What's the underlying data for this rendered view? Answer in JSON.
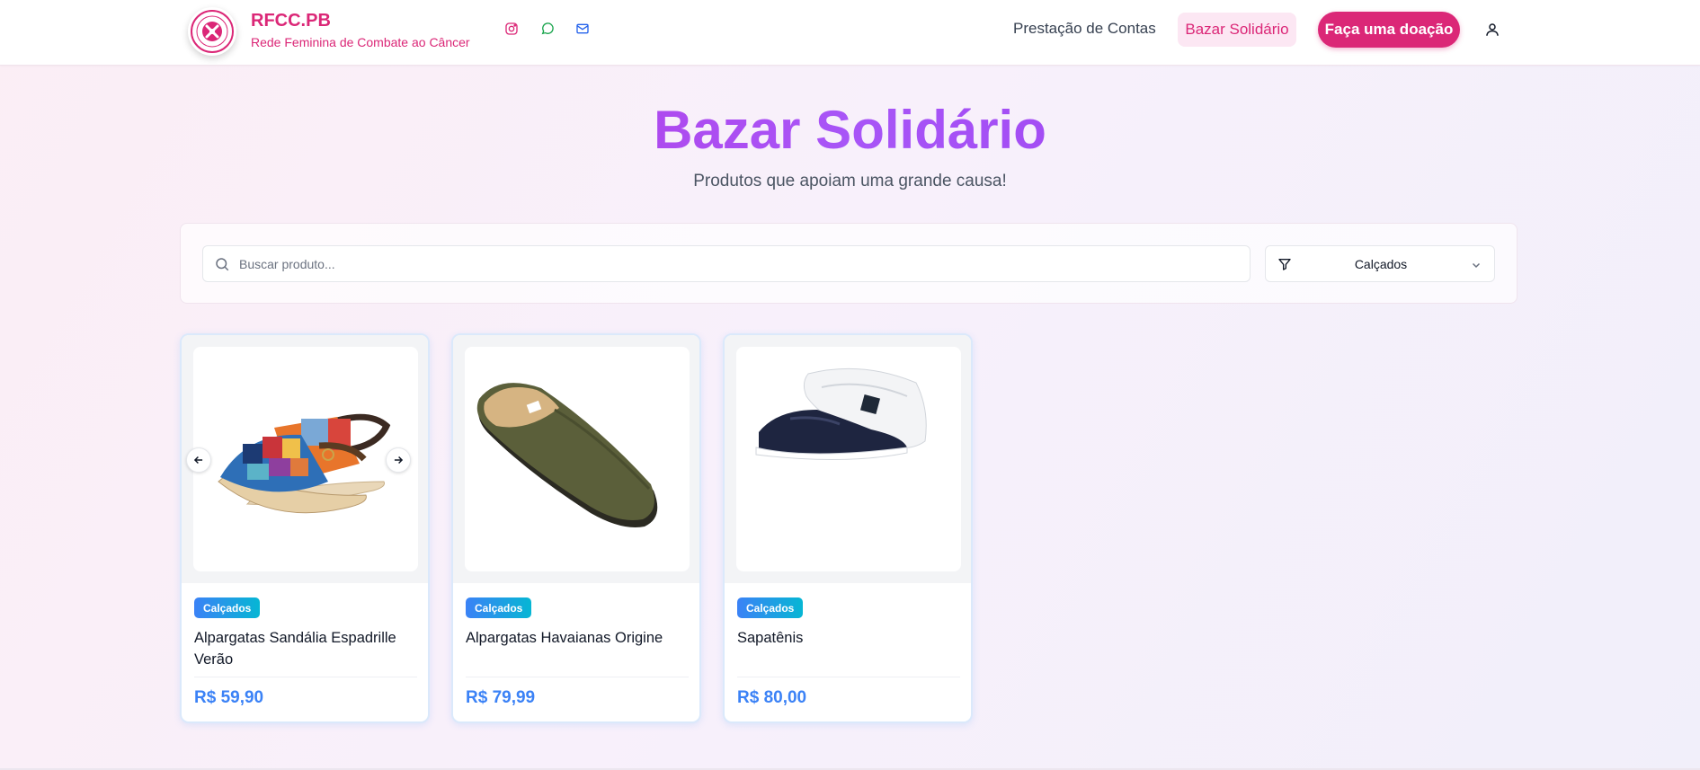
{
  "header": {
    "brand_title": "RFCC.PB",
    "brand_subtitle": "Rede Feminina de Combate ao Câncer",
    "social_icons": [
      "instagram-icon",
      "whatsapp-icon",
      "mail-icon"
    ],
    "nav": {
      "accountability": "Prestação de Contas",
      "bazaar": "Bazar Solidário",
      "donate": "Faça uma doação"
    }
  },
  "hero": {
    "title": "Bazar Solidário",
    "subtitle": "Produtos que apoiam uma grande causa!"
  },
  "filters": {
    "search_placeholder": "Buscar produto...",
    "category_selected": "Calçados"
  },
  "products": [
    {
      "category": "Calçados",
      "name": "Alpargatas Sandália Espadrille Verão",
      "price": "R$ 59,90",
      "has_carousel": true
    },
    {
      "category": "Calçados",
      "name": "Alpargatas Havaianas Origine",
      "price": "R$ 79,99",
      "has_carousel": false
    },
    {
      "category": "Calçados",
      "name": "Sapatênis",
      "price": "R$ 80,00",
      "has_carousel": false
    }
  ],
  "colors": {
    "brand_pink": "#db2777",
    "hero_purple": "#a855f7",
    "price_blue": "#3b82f6",
    "badge_gradient": [
      "#3b82f6",
      "#06b6d4"
    ]
  }
}
